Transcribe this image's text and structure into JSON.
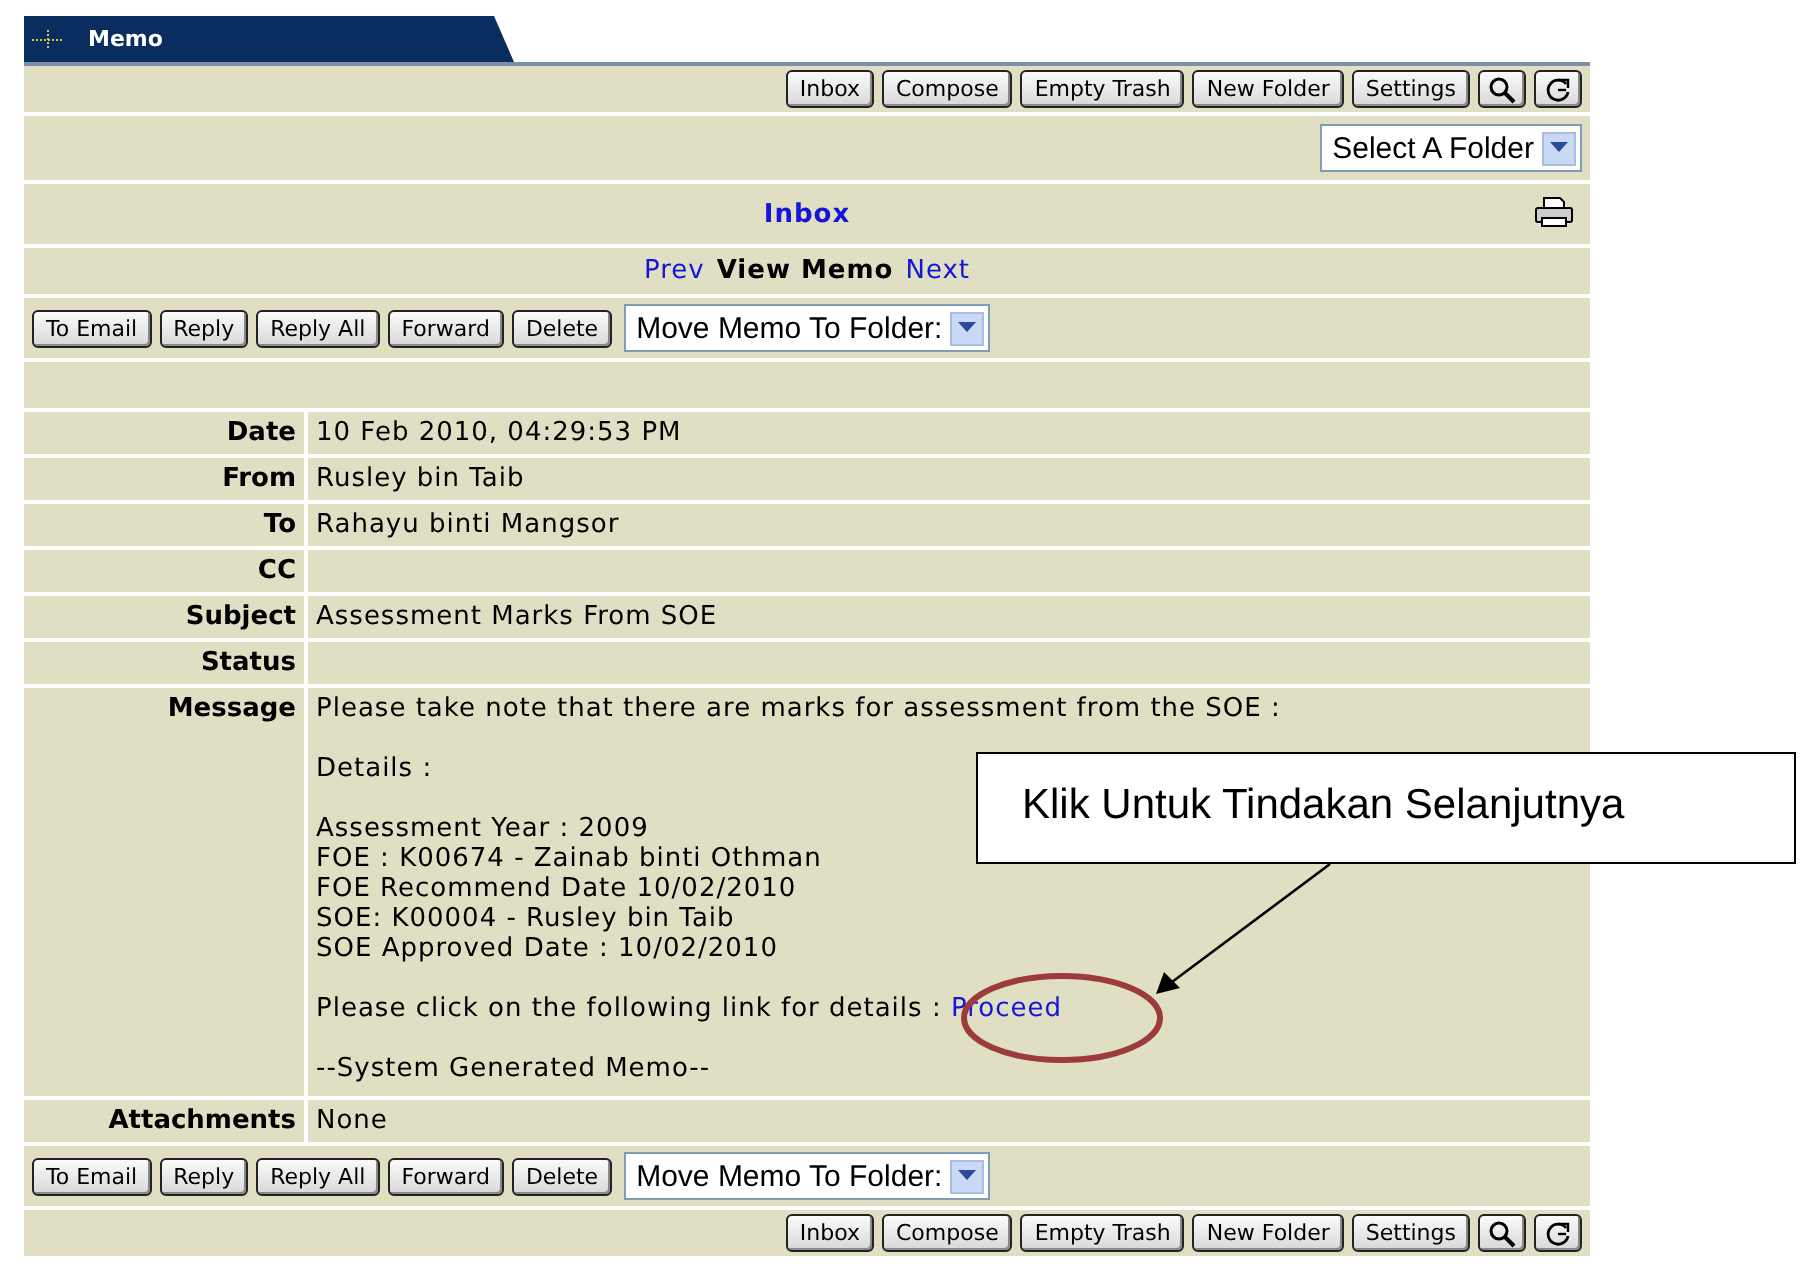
{
  "tab": {
    "title": "Memo"
  },
  "toolbar_top": [
    "Inbox",
    "Compose",
    "Empty Trash",
    "New Folder",
    "Settings"
  ],
  "folder_select": {
    "value": "Select A Folder"
  },
  "heading": "Inbox",
  "pager": {
    "prev": "Prev",
    "title": "View Memo",
    "next": "Next"
  },
  "actions_top": {
    "buttons": [
      "To Email",
      "Reply",
      "Reply All",
      "Forward",
      "Delete"
    ],
    "move_select": "Move Memo To Folder:"
  },
  "fields": [
    {
      "label": "Date",
      "value": "10 Feb 2010, 04:29:53 PM"
    },
    {
      "label": "From",
      "value": "Rusley bin Taib"
    },
    {
      "label": "To",
      "value": "Rahayu binti Mangsor"
    },
    {
      "label": "CC"
    },
    {
      "label": "Subject",
      "value": "Assessment Marks From SOE"
    },
    {
      "label": "Status"
    }
  ],
  "message": {
    "label": "Message",
    "intro": "Please take note that there are marks for assessment from the SOE :",
    "details_label": "Details :",
    "details": [
      "Assessment Year : 2009",
      "FOE : K00674 - Zainab binti Othman",
      "FOE Recommend Date 10/02/2010",
      "SOE: K00004 - Rusley bin Taib",
      "SOE Approved Date : 10/02/2010"
    ],
    "link_prompt": "Please click on the following link for details :",
    "link": "Proceed",
    "footer": "--System Generated Memo--"
  },
  "attachments": {
    "label": "Attachments",
    "value": "None"
  },
  "actions_bottom": {
    "buttons": [
      "To Email",
      "Reply",
      "Reply All",
      "Forward",
      "Delete"
    ],
    "move_select": "Move Memo To Folder:"
  },
  "toolbar_bottom": [
    "Inbox",
    "Compose",
    "Empty Trash",
    "New Folder",
    "Settings"
  ],
  "callout": "Klik Untuk Tindakan Selanjutnya"
}
